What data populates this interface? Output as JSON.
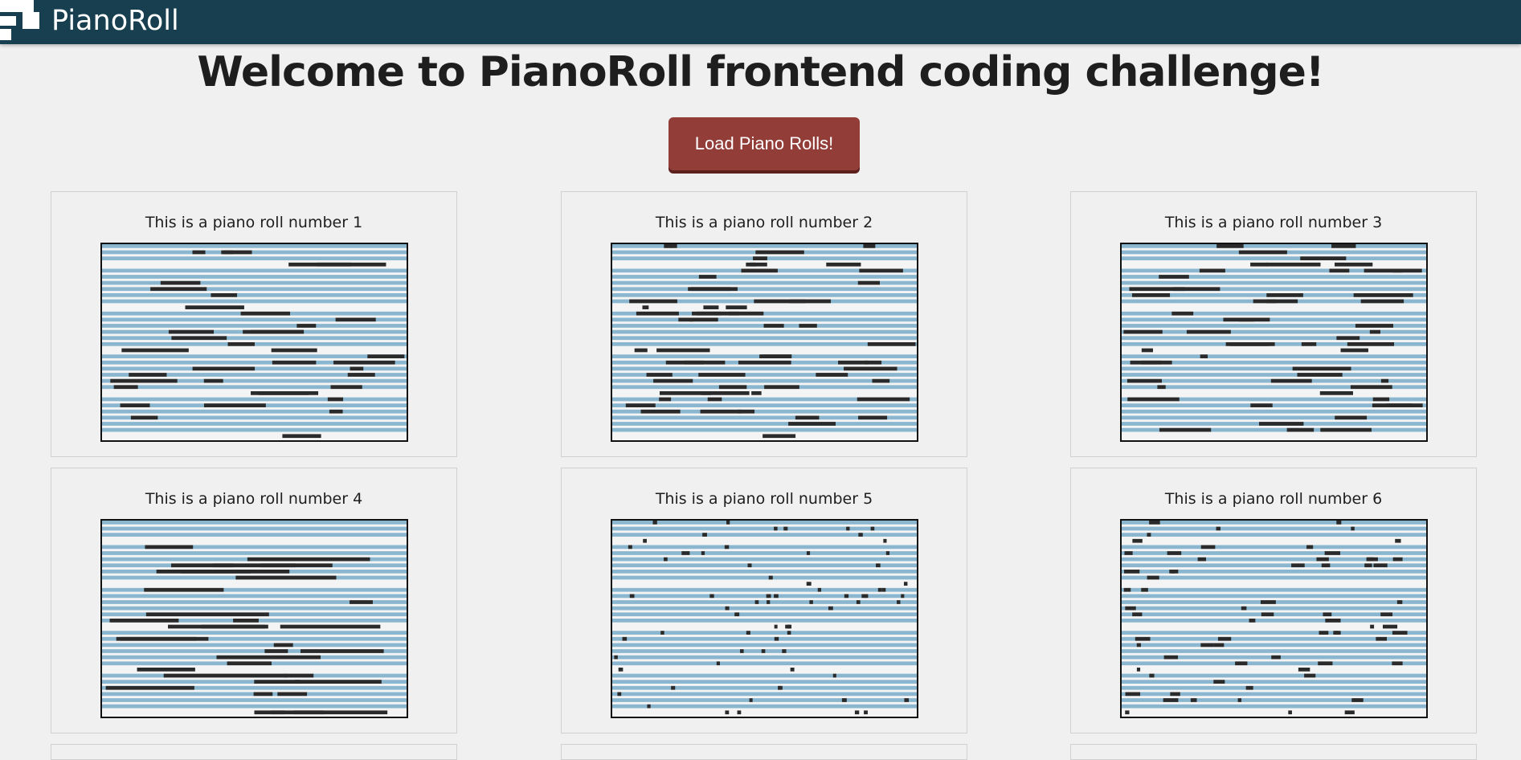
{
  "app": {
    "brand": "PianoRoll"
  },
  "page": {
    "title": "Welcome to PianoRoll frontend coding challenge!"
  },
  "actions": {
    "load_label": "Load Piano Rolls!"
  },
  "colors": {
    "navbar": "#173f50",
    "button": "#923d38",
    "lane_blue": "#8ab7cf",
    "lane_light": "#f4f4f4",
    "note": "#2a2a2a"
  },
  "rolls": [
    {
      "caption": "This is a piano roll number 1"
    },
    {
      "caption": "This is a piano roll number 2"
    },
    {
      "caption": "This is a piano roll number 3"
    },
    {
      "caption": "This is a piano roll number 4"
    },
    {
      "caption": "This is a piano roll number 5"
    },
    {
      "caption": "This is a piano roll number 6"
    }
  ]
}
